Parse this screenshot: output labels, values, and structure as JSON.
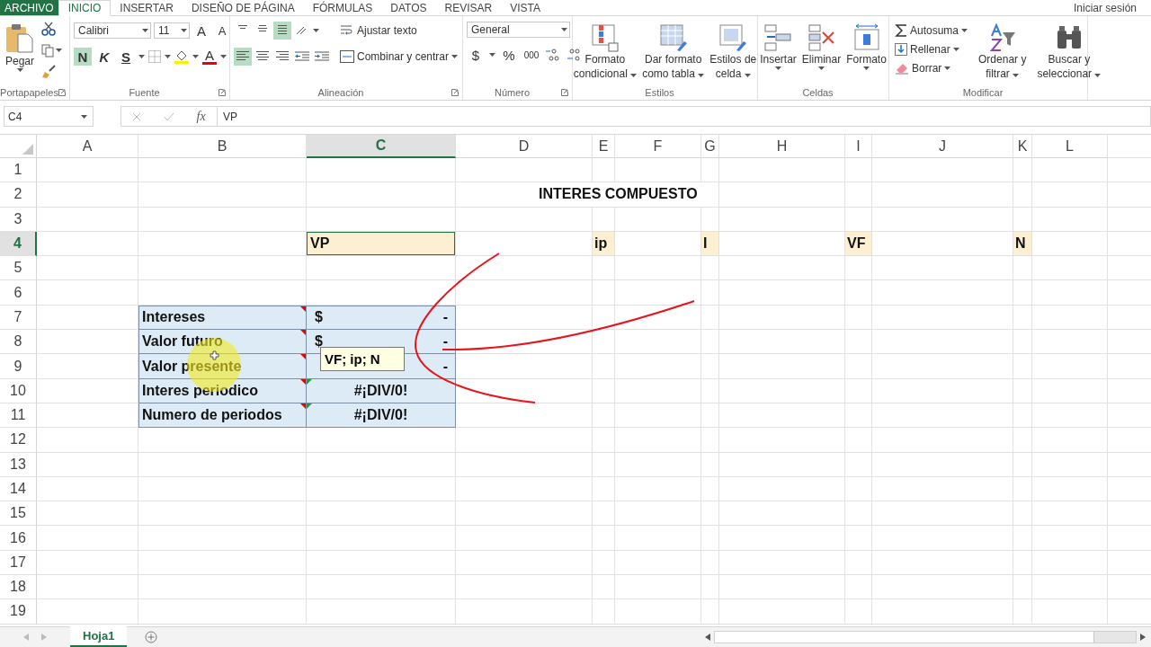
{
  "tabs": [
    {
      "label": "ARCHIVO",
      "kind": "file",
      "selected": false
    },
    {
      "label": "INICIO",
      "kind": "tab",
      "selected": true
    },
    {
      "label": "INSERTAR",
      "kind": "tab",
      "selected": false
    },
    {
      "label": "DISEÑO DE PÁGINA",
      "kind": "tab",
      "selected": false
    },
    {
      "label": "FÓRMULAS",
      "kind": "tab",
      "selected": false
    },
    {
      "label": "DATOS",
      "kind": "tab",
      "selected": false
    },
    {
      "label": "REVISAR",
      "kind": "tab",
      "selected": false
    },
    {
      "label": "VISTA",
      "kind": "tab",
      "selected": false
    }
  ],
  "account": "Iniciar sesión",
  "ribbon": {
    "groups": [
      {
        "kind": "clipboard",
        "label": "Portapapeles",
        "launcher": true,
        "paste": "Pegar"
      },
      {
        "kind": "font",
        "label": "Fuente",
        "launcher": true,
        "font_name": "Calibri",
        "font_size": "11",
        "grow": "A",
        "shrink": "A",
        "bold": "N",
        "bold_on": true,
        "italic": "K",
        "underline": "S",
        "font_color": "A"
      },
      {
        "kind": "alignment",
        "label": "Alineación",
        "launcher": true,
        "vertical_aligns": [
          {
            "kind": "top",
            "selected": false
          },
          {
            "kind": "middle",
            "selected": false
          },
          {
            "kind": "bottom",
            "selected": true
          }
        ],
        "horizontal_aligns": [
          {
            "kind": "left",
            "selected": true
          },
          {
            "kind": "center",
            "selected": false
          },
          {
            "kind": "right",
            "selected": false
          }
        ],
        "wrap": "Ajustar texto",
        "merge": "Combinar y centrar"
      },
      {
        "kind": "number",
        "label": "Número",
        "launcher": true,
        "format": "General",
        "currency": "$",
        "percent": "%",
        "thousands": "000"
      },
      {
        "kind": "styles",
        "label": "Estilos",
        "buttons": [
          {
            "lines": [
              "Formato",
              "condicional"
            ]
          },
          {
            "lines": [
              "Dar formato",
              "como tabla"
            ]
          },
          {
            "lines": [
              "Estilos de",
              "celda"
            ]
          }
        ]
      },
      {
        "kind": "cells",
        "label": "Celdas",
        "buttons": [
          {
            "label": "Insertar"
          },
          {
            "label": "Eliminar"
          },
          {
            "label": "Formato"
          }
        ]
      },
      {
        "kind": "editing",
        "label": "Modificar",
        "small": [
          "Autosuma",
          "Rellenar",
          "Borrar"
        ],
        "buttons": [
          {
            "lines": [
              "Ordenar y",
              "filtrar"
            ]
          },
          {
            "lines": [
              "Buscar y",
              "seleccionar"
            ]
          }
        ]
      }
    ]
  },
  "formula_bar": {
    "name_box": "C4",
    "function_label": "fx",
    "formula": "VP"
  },
  "sheet": {
    "columns": [
      {
        "label": "A",
        "selected": false
      },
      {
        "label": "B",
        "selected": false
      },
      {
        "label": "C",
        "selected": true
      },
      {
        "label": "D",
        "selected": false
      },
      {
        "label": "E",
        "selected": false
      },
      {
        "label": "F",
        "selected": false
      },
      {
        "label": "G",
        "selected": false
      },
      {
        "label": "H",
        "selected": false
      },
      {
        "label": "I",
        "selected": false
      },
      {
        "label": "J",
        "selected": false
      },
      {
        "label": "K",
        "selected": false
      },
      {
        "label": "L",
        "selected": false
      }
    ],
    "rows": [
      {
        "header": "1",
        "selected": false
      },
      {
        "header": "2",
        "selected": false,
        "cells": [
          {
            "kind": "empty"
          },
          {
            "kind": "empty"
          },
          {
            "kind": "empty"
          },
          {
            "kind": "title",
            "text": "INTERES COMPUESTO"
          },
          {
            "kind": "empty"
          },
          {
            "kind": "empty"
          },
          {
            "kind": "empty"
          },
          {
            "kind": "empty"
          },
          {
            "kind": "empty"
          },
          {
            "kind": "empty"
          },
          {
            "kind": "empty"
          },
          {
            "kind": "empty"
          }
        ]
      },
      {
        "header": "3",
        "selected": false
      },
      {
        "header": "4",
        "selected": true,
        "cells": [
          {
            "kind": "empty"
          },
          {
            "kind": "empty"
          },
          {
            "kind": "highlight",
            "text": "VP",
            "selected": true
          },
          {
            "kind": "empty"
          },
          {
            "kind": "highlight",
            "text": "ip",
            "selected": false
          },
          {
            "kind": "empty"
          },
          {
            "kind": "highlight",
            "text": "I",
            "selected": false
          },
          {
            "kind": "empty"
          },
          {
            "kind": "highlight",
            "text": "VF",
            "selected": false
          },
          {
            "kind": "empty"
          },
          {
            "kind": "highlight",
            "text": "N",
            "selected": false
          },
          {
            "kind": "empty"
          }
        ]
      },
      {
        "header": "5",
        "selected": false
      },
      {
        "header": "6",
        "selected": false
      },
      {
        "header": "7",
        "selected": false,
        "cells": [
          {
            "kind": "empty"
          },
          {
            "kind": "label",
            "text": "Intereses",
            "comment": true
          },
          {
            "kind": "accounting",
            "symbol": "$",
            "amount": "-",
            "error_flag": false
          },
          {
            "kind": "empty"
          },
          {
            "kind": "empty"
          },
          {
            "kind": "empty"
          },
          {
            "kind": "empty"
          },
          {
            "kind": "empty"
          },
          {
            "kind": "empty"
          },
          {
            "kind": "empty"
          },
          {
            "kind": "empty"
          },
          {
            "kind": "empty"
          }
        ]
      },
      {
        "header": "8",
        "selected": false,
        "cells": [
          {
            "kind": "empty"
          },
          {
            "kind": "label",
            "text": "Valor futuro",
            "comment": true
          },
          {
            "kind": "accounting",
            "symbol": "$",
            "amount": "-",
            "error_flag": false
          },
          {
            "kind": "empty"
          },
          {
            "kind": "empty"
          },
          {
            "kind": "empty"
          },
          {
            "kind": "empty"
          },
          {
            "kind": "empty"
          },
          {
            "kind": "empty"
          },
          {
            "kind": "empty"
          },
          {
            "kind": "empty"
          },
          {
            "kind": "empty"
          }
        ]
      },
      {
        "header": "9",
        "selected": false,
        "cells": [
          {
            "kind": "empty"
          },
          {
            "kind": "label",
            "text": "Valor presente",
            "comment": true
          },
          {
            "kind": "accounting",
            "amount": "-",
            "error_flag": false
          },
          {
            "kind": "empty"
          },
          {
            "kind": "empty"
          },
          {
            "kind": "empty"
          },
          {
            "kind": "empty"
          },
          {
            "kind": "empty"
          },
          {
            "kind": "empty"
          },
          {
            "kind": "empty"
          },
          {
            "kind": "empty"
          },
          {
            "kind": "empty"
          }
        ]
      },
      {
        "header": "10",
        "selected": false,
        "cells": [
          {
            "kind": "empty"
          },
          {
            "kind": "label",
            "text": "Interes periodico",
            "comment": true
          },
          {
            "kind": "error",
            "text": "#¡DIV/0!",
            "error_flag": true
          },
          {
            "kind": "empty"
          },
          {
            "kind": "empty"
          },
          {
            "kind": "empty"
          },
          {
            "kind": "empty"
          },
          {
            "kind": "empty"
          },
          {
            "kind": "empty"
          },
          {
            "kind": "empty"
          },
          {
            "kind": "empty"
          },
          {
            "kind": "empty"
          }
        ]
      },
      {
        "header": "11",
        "selected": false,
        "cells": [
          {
            "kind": "empty"
          },
          {
            "kind": "label",
            "text": "Numero de periodos",
            "comment": true
          },
          {
            "kind": "error",
            "text": "#¡DIV/0!",
            "error_flag": true
          },
          {
            "kind": "empty"
          },
          {
            "kind": "empty"
          },
          {
            "kind": "empty"
          },
          {
            "kind": "empty"
          },
          {
            "kind": "empty"
          },
          {
            "kind": "empty"
          },
          {
            "kind": "empty"
          },
          {
            "kind": "empty"
          },
          {
            "kind": "empty"
          }
        ]
      },
      {
        "header": "12",
        "selected": false
      },
      {
        "header": "13",
        "selected": false
      },
      {
        "header": "14",
        "selected": false
      },
      {
        "header": "15",
        "selected": false
      },
      {
        "header": "16",
        "selected": false
      },
      {
        "header": "17",
        "selected": false
      },
      {
        "header": "18",
        "selected": false
      },
      {
        "header": "19",
        "selected": false
      }
    ],
    "tooltip": "VF; ip; N"
  },
  "sheet_tabs": [
    {
      "label": "Hoja1",
      "selected": true
    }
  ]
}
